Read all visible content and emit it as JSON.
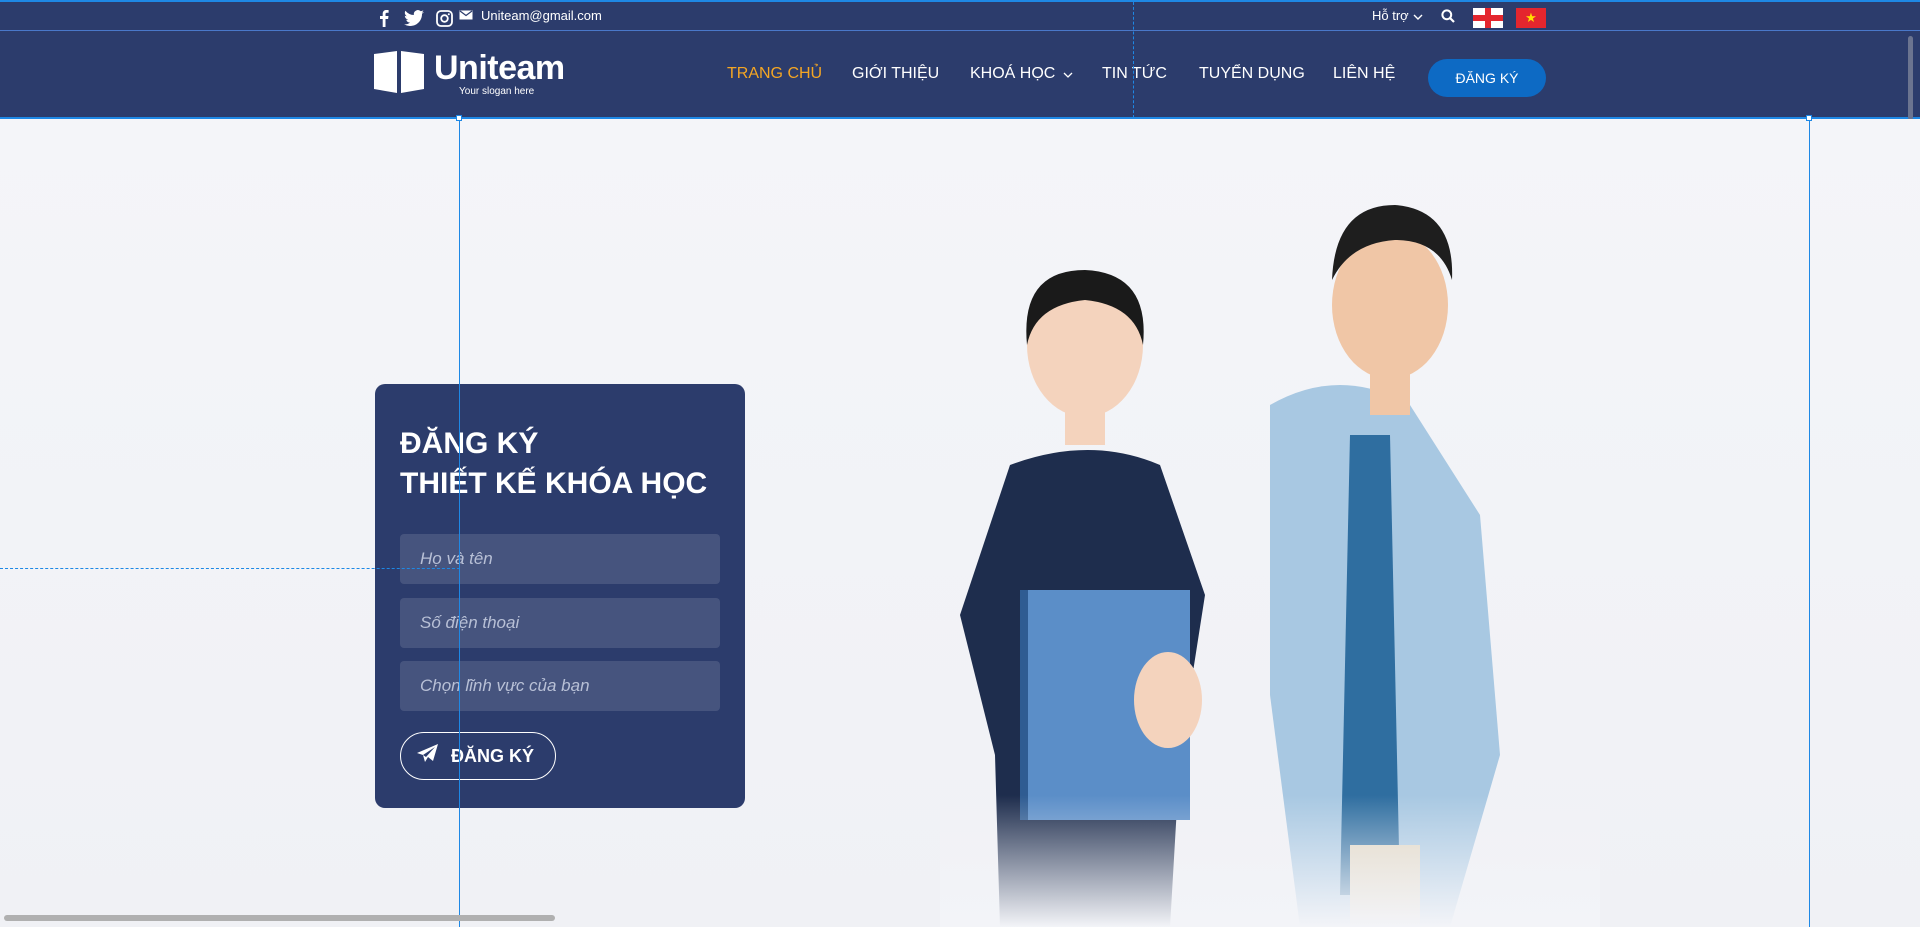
{
  "topbar": {
    "email": "Uniteam@gmail.com",
    "support_label": "Hỗ trợ",
    "social_icons": [
      "facebook-icon",
      "twitter-icon",
      "instagram-icon"
    ]
  },
  "header": {
    "logo_name": "Uniteam",
    "logo_slogan": "Your slogan here",
    "nav": [
      {
        "label": "TRANG CHỦ",
        "active": true
      },
      {
        "label": "GIỚI THIỆU",
        "active": false
      },
      {
        "label": "KHOÁ HỌC",
        "active": false,
        "dropdown": true
      },
      {
        "label": "TIN TỨC",
        "active": false
      },
      {
        "label": "TUYỂN DỤNG",
        "active": false
      },
      {
        "label": "LIÊN HỆ",
        "active": false
      }
    ],
    "cta_label": "ĐĂNG KÝ"
  },
  "form": {
    "title_line1": "ĐĂNG KÝ",
    "title_line2": "THIẾT KẾ KHÓA HỌC",
    "name_placeholder": "Họ và tên",
    "phone_placeholder": "Số điện thoại",
    "field_placeholder": "Chọn lĩnh vực của bạn",
    "submit_label": "ĐĂNG KÝ"
  },
  "colors": {
    "navy": "#2c3c6c",
    "accent_orange": "#f5a623",
    "cta_blue": "#0d6ac4",
    "guide_blue": "#1e88e5"
  }
}
